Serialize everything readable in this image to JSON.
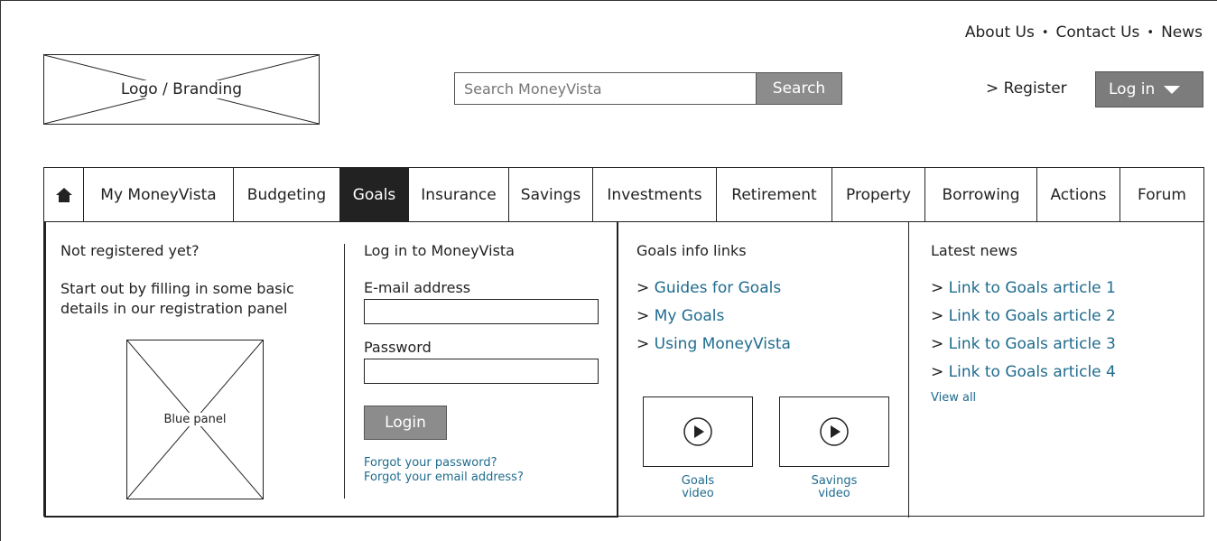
{
  "top_links": [
    "About Us",
    "Contact Us",
    "News"
  ],
  "logo": {
    "label": "Logo / Branding"
  },
  "search": {
    "placeholder": "Search MoneyVista",
    "button_label": "Search"
  },
  "account": {
    "register_label": "> Register",
    "login_label": "Log in"
  },
  "nav": {
    "home_icon": "home-icon",
    "items": [
      "My MoneyVista",
      "Budgeting",
      "Goals",
      "Insurance",
      "Savings",
      "Investments",
      "Retirement",
      "Property",
      "Borrowing",
      "Actions",
      "Forum"
    ],
    "active": "Goals"
  },
  "dropdown": {
    "register": {
      "title": "Not registered yet?",
      "description": "Start out by filling in some basic details in our registration panel",
      "panel_label": "Blue panel"
    },
    "login": {
      "title": "Log in to MoneyVista",
      "email_label": "E-mail address",
      "email_value": "",
      "password_label": "Password",
      "password_value": "",
      "button_label": "Login",
      "forgot_password": "Forgot your password?",
      "forgot_email": "Forgot your email address?"
    },
    "info": {
      "title": "Goals info links",
      "links": [
        "Guides for Goals",
        "My Goals",
        "Using MoneyVista"
      ],
      "videos": [
        {
          "label_line1": "Goals",
          "label_line2": "video",
          "icon": "play-icon"
        },
        {
          "label_line1": "Savings",
          "label_line2": "video",
          "icon": "play-icon"
        }
      ]
    },
    "news": {
      "title": "Latest news",
      "links": [
        "Link to Goals article 1",
        "Link to Goals article 2",
        "Link to Goals article 3",
        "Link to Goals article 4"
      ],
      "view_all": "View all"
    }
  },
  "colors": {
    "link": "#1f6b8e",
    "button_gray": "#8c8c8c",
    "active_nav": "#222222"
  }
}
